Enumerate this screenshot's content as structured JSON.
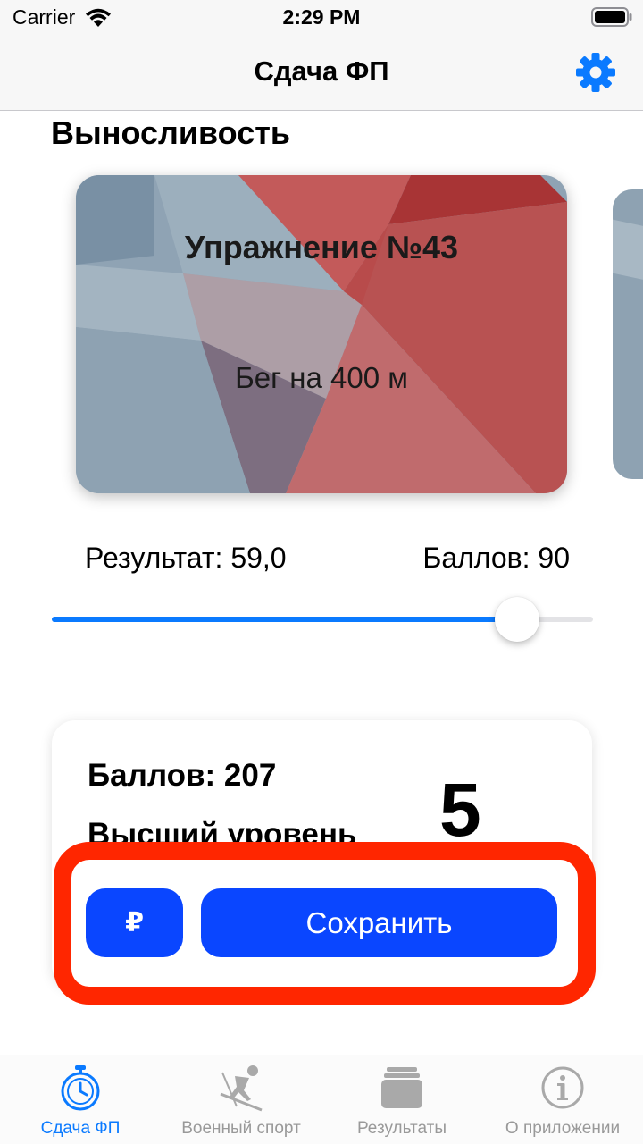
{
  "status_bar": {
    "carrier": "Carrier",
    "time": "2:29 PM"
  },
  "nav": {
    "title": "Сдача ФП",
    "settings_icon": "gear-icon"
  },
  "section": {
    "title": "Выносливость"
  },
  "exercise_card": {
    "title": "Упражнение №43",
    "subtitle": "Бег на 400 м"
  },
  "result": {
    "result_label": "Результат: 59,0",
    "score_label": "Баллов: 90",
    "slider_fraction": 0.86
  },
  "summary": {
    "total_score": "Баллов: 207",
    "level": "Высший уровень",
    "grade": "5"
  },
  "actions": {
    "donate_label": "₽",
    "save_label": "Сохранить"
  },
  "colors": {
    "accent": "#0a7aff",
    "button": "#0a46ff",
    "highlight": "#ff2600"
  },
  "tabs": [
    {
      "label": "Сдача ФП",
      "icon": "stopwatch-icon",
      "active": true
    },
    {
      "label": "Военный спорт",
      "icon": "skier-icon",
      "active": false
    },
    {
      "label": "Результаты",
      "icon": "tray-stack-icon",
      "active": false
    },
    {
      "label": "О приложении",
      "icon": "info-icon",
      "active": false
    }
  ]
}
